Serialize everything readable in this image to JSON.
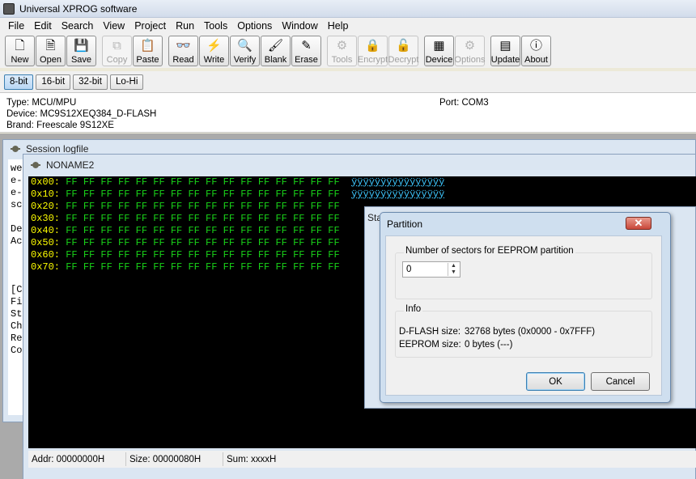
{
  "window": {
    "title": "Universal XPROG software"
  },
  "menu": [
    "File",
    "Edit",
    "Search",
    "View",
    "Project",
    "Run",
    "Tools",
    "Options",
    "Window",
    "Help"
  ],
  "toolbar": [
    {
      "label": "New",
      "icon": "new-doc-icon",
      "glyph": "🗋",
      "enabled": true
    },
    {
      "label": "Open",
      "icon": "open-doc-icon",
      "glyph": "🗎",
      "enabled": true
    },
    {
      "label": "Save",
      "icon": "save-icon",
      "glyph": "💾",
      "enabled": true
    },
    {
      "label": "Copy",
      "icon": "copy-icon",
      "glyph": "⧉",
      "enabled": false
    },
    {
      "label": "Paste",
      "icon": "paste-icon",
      "glyph": "📋",
      "enabled": true
    },
    {
      "label": "Read",
      "icon": "read-glasses-icon",
      "glyph": "👓",
      "enabled": true
    },
    {
      "label": "Write",
      "icon": "write-lightning-icon",
      "glyph": "⚡",
      "enabled": true
    },
    {
      "label": "Verify",
      "icon": "verify-magnifier-icon",
      "glyph": "🔍",
      "enabled": true
    },
    {
      "label": "Blank",
      "icon": "blank-brush-icon",
      "glyph": "🖌",
      "enabled": true
    },
    {
      "label": "Erase",
      "icon": "erase-pencil-icon",
      "glyph": "✎",
      "enabled": true
    },
    {
      "label": "Tools",
      "icon": "tools-icon",
      "glyph": "⚙",
      "enabled": false
    },
    {
      "label": "Encrypt",
      "icon": "lock-icon",
      "glyph": "🔒",
      "enabled": false
    },
    {
      "label": "Decrypt",
      "icon": "unlock-icon",
      "glyph": "🔓",
      "enabled": false
    },
    {
      "label": "Device",
      "icon": "chip-icon",
      "glyph": "▦",
      "enabled": true
    },
    {
      "label": "Options",
      "icon": "options-icon",
      "glyph": "⚙",
      "enabled": false
    },
    {
      "label": "Update",
      "icon": "update-icon",
      "glyph": "▤",
      "enabled": true
    },
    {
      "label": "About",
      "icon": "about-icon",
      "glyph": "ⓘ",
      "enabled": true
    }
  ],
  "bit_tabs": [
    {
      "label": "8-bit",
      "selected": true
    },
    {
      "label": "16-bit",
      "selected": false
    },
    {
      "label": "32-bit",
      "selected": false
    },
    {
      "label": "Lo-Hi",
      "selected": false
    }
  ],
  "info": {
    "type": "Type: MCU/MPU",
    "device": "Device: MC9S12XEQ384_D-FLASH",
    "brand": "Brand: Freescale 9S12XE",
    "port": "Port: COM3"
  },
  "session": {
    "title": "Session logfile",
    "lines": [
      "we",
      "e-",
      "e-",
      "sc",
      "",
      "De",
      "Ac",
      "",
      "",
      "",
      "[C",
      "Fi",
      "St",
      "Ch",
      "Re",
      "Co"
    ]
  },
  "editor": {
    "title": "NONAME2",
    "rows": [
      {
        "addr": "0x00:",
        "bytes": "FF FF FF FF FF FF FF FF FF FF FF FF FF FF FF FF",
        "ascii": "ÿÿÿÿÿÿÿÿÿÿÿÿÿÿÿÿ"
      },
      {
        "addr": "0x10:",
        "bytes": "FF FF FF FF FF FF FF FF FF FF FF FF FF FF FF FF",
        "ascii": "ÿÿÿÿÿÿÿÿÿÿÿÿÿÿÿÿ"
      },
      {
        "addr": "0x20:",
        "bytes": "FF FF FF FF FF FF FF FF FF FF FF FF FF FF FF FF",
        "ascii": ""
      },
      {
        "addr": "0x30:",
        "bytes": "FF FF FF FF FF FF FF FF FF FF FF FF FF FF FF FF",
        "ascii": ""
      },
      {
        "addr": "0x40:",
        "bytes": "FF FF FF FF FF FF FF FF FF FF FF FF FF FF FF FF",
        "ascii": ""
      },
      {
        "addr": "0x50:",
        "bytes": "FF FF FF FF FF FF FF FF FF FF FF FF FF FF FF FF",
        "ascii": ""
      },
      {
        "addr": "0x60:",
        "bytes": "FF FF FF FF FF FF FF FF FF FF FF FF FF FF FF FF",
        "ascii": ""
      },
      {
        "addr": "0x70:",
        "bytes": "FF FF FF FF FF FF FF FF FF FF FF FF FF FF FF FF",
        "ascii": ""
      }
    ],
    "status": {
      "addr": "Addr: 00000000H",
      "size": "Size: 00000080H",
      "sum": "Sum: xxxxH"
    }
  },
  "status_window": {
    "title": "Stat"
  },
  "dialog": {
    "title": "Partition",
    "close_glyph": "✕",
    "sectors_label": "Number of sectors for EEPROM partition",
    "sectors_value": "0",
    "info_label": "Info",
    "dflash_label": "D-FLASH size:",
    "dflash_value": "32768 bytes (0x0000 - 0x7FFF)",
    "eeprom_label": "EEPROM size:",
    "eeprom_value": "0 bytes (---)",
    "ok": "OK",
    "cancel": "Cancel"
  },
  "colors": {
    "address": "#ffff00",
    "bytes": "#19d219",
    "ascii": "#3ec8ff",
    "hex_bg": "#000000"
  }
}
